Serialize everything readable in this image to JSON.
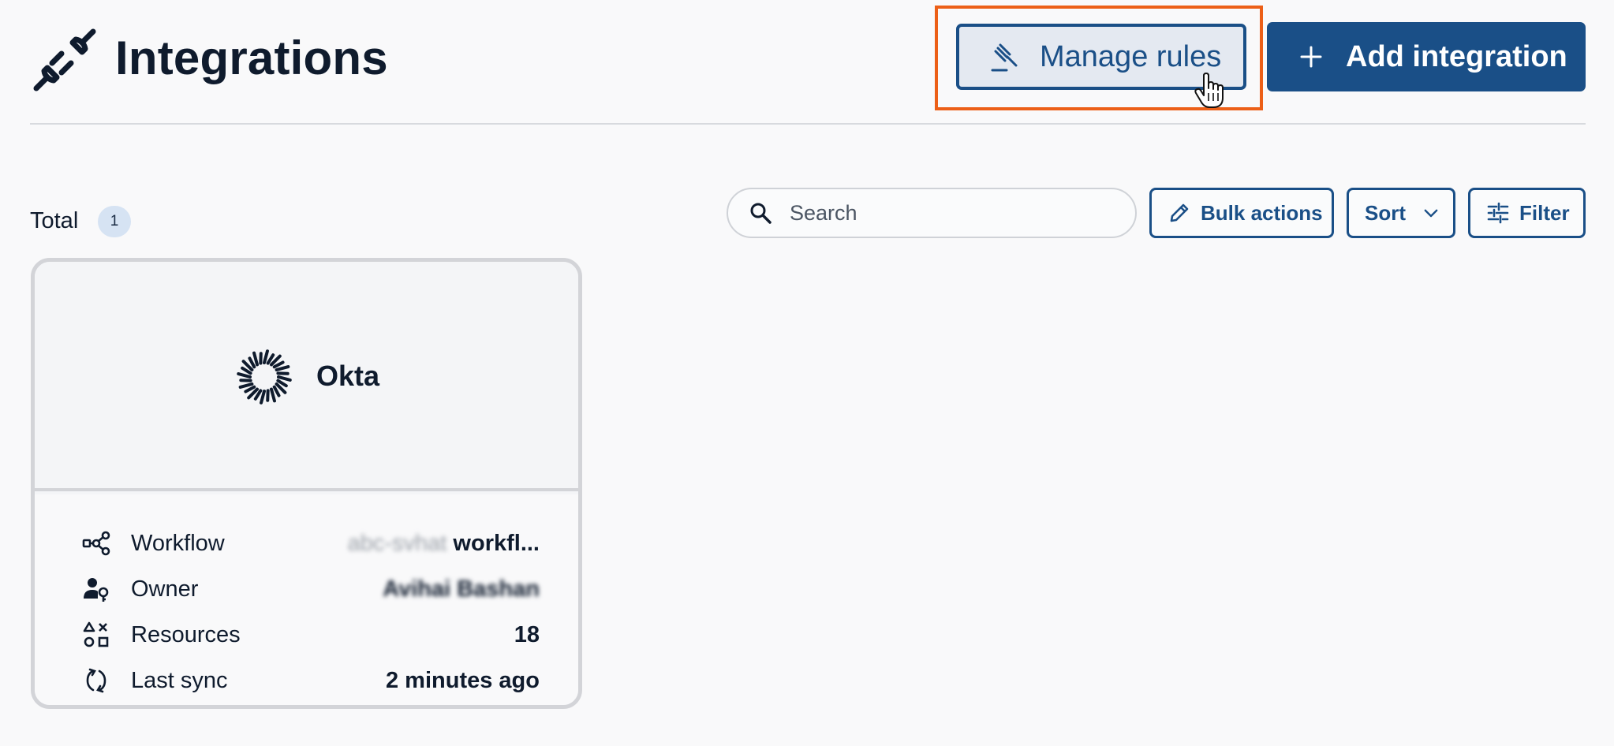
{
  "header": {
    "title": "Integrations",
    "manage_rules_label": "Manage rules",
    "add_integration_label": "Add integration"
  },
  "toolbar": {
    "total_label": "Total",
    "total_count": "1",
    "search_placeholder": "Search",
    "bulk_actions_label": "Bulk actions",
    "sort_label": "Sort",
    "filter_label": "Filter"
  },
  "integration_card": {
    "name": "Okta",
    "rows": [
      {
        "icon": "workflow-icon",
        "label": "Workflow",
        "value_blurred": "abc-svhat",
        "value": "workfl..."
      },
      {
        "icon": "owner-key-icon",
        "label": "Owner",
        "value_blurred": "Avihai Bashan",
        "value": ""
      },
      {
        "icon": "resources-shapes-icon",
        "label": "Resources",
        "value": "18"
      },
      {
        "icon": "sync-icon",
        "label": "Last sync",
        "value": "2 minutes ago"
      }
    ]
  },
  "colors": {
    "primary": "#1a4f87",
    "highlight": "#ec5f17",
    "background": "#f9f9fa",
    "text": "#0f1b2d"
  }
}
